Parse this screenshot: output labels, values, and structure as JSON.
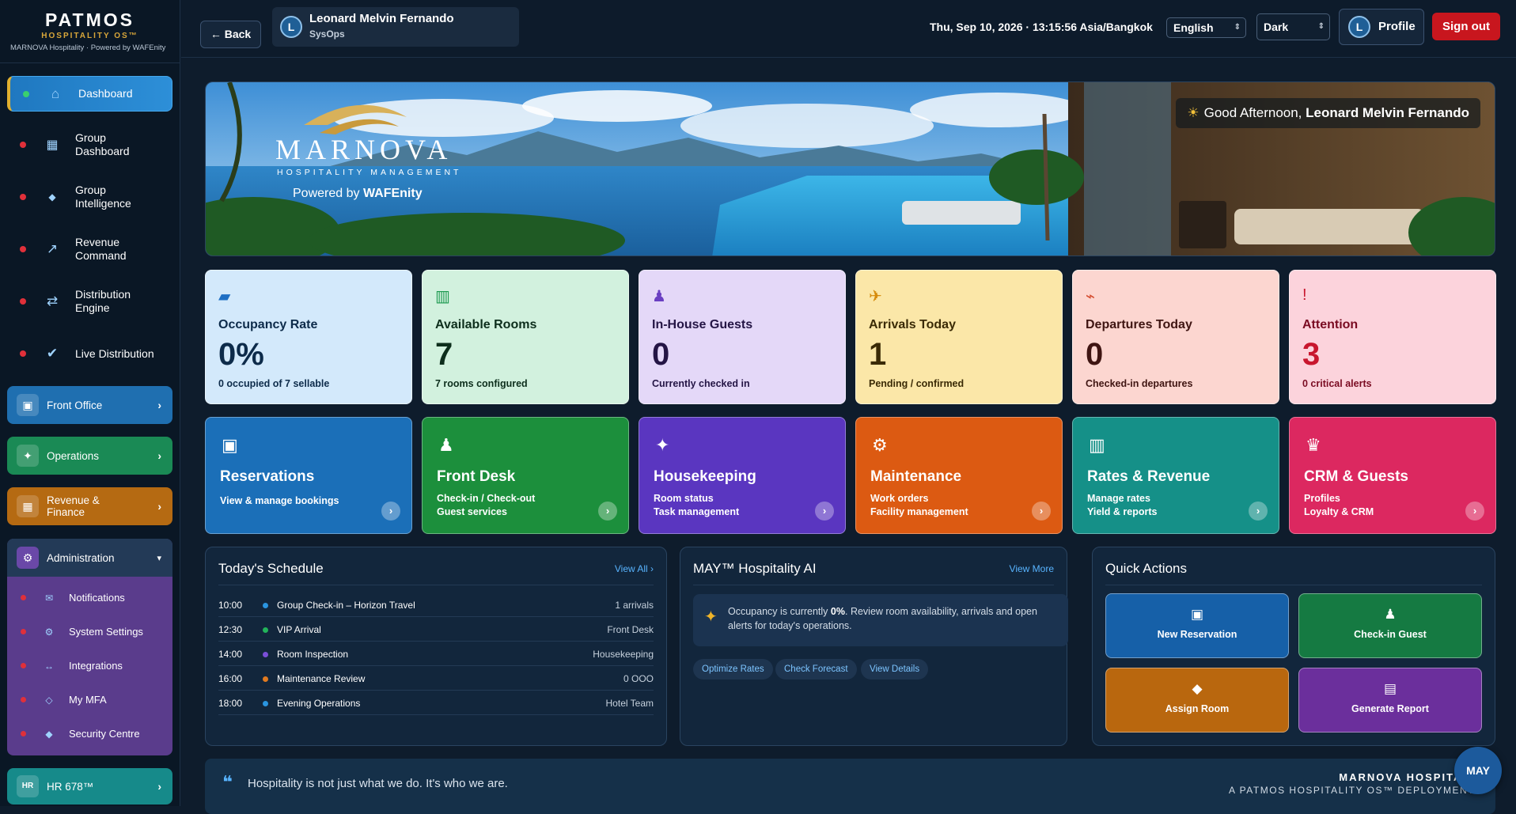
{
  "brand": {
    "name": "PATMOS",
    "os": "HOSPITALITY OS™",
    "sub": "MARNOVA Hospitality · Powered by WAFEnity"
  },
  "sidebar": {
    "items": [
      {
        "label": "Dashboard",
        "icon": "home-icon",
        "active": true
      },
      {
        "label": "Group Dashboard",
        "icon": "grid-icon"
      },
      {
        "label": "Group Intelligence",
        "icon": "diamond-icon"
      },
      {
        "label": "Revenue Command",
        "icon": "trend-arrow-icon"
      },
      {
        "label": "Distribution Engine",
        "icon": "swap-arrows-icon"
      },
      {
        "label": "Live Distribution",
        "icon": "check-icon"
      }
    ],
    "groups": [
      {
        "label": "Front Office",
        "color": "#1f6fb0"
      },
      {
        "label": "Operations",
        "color": "#1a8a55"
      },
      {
        "label": "Revenue & Finance",
        "color": "#b56a12"
      },
      {
        "label": "Administration",
        "color": "#2a3f5c"
      }
    ],
    "admin_items": [
      "Notifications",
      "System Settings",
      "Integrations",
      "My MFA",
      "Security Centre"
    ],
    "hr": {
      "badge": "HR",
      "label": "HR 678™"
    }
  },
  "topbar": {
    "back_label": "← Back",
    "user": {
      "initial": "L",
      "name": "Leonard Melvin Fernando",
      "role": "SysOps"
    },
    "clock": "Thu, Sep 10, 2026 · 13:15:56 Asia/Bangkok",
    "language": "English",
    "theme": "Dark",
    "profile_label": "Profile",
    "signout_label": "Sign out"
  },
  "hero": {
    "logo_word": "MARNOVA",
    "logo_tag": "HOSPITALITY MANAGEMENT",
    "powered_prefix": "Powered by ",
    "powered_brand": "WAFEnity",
    "greeting_prefix": "Good Afternoon, ",
    "greeting_name": "Leonard Melvin Fernando"
  },
  "stats": [
    {
      "title": "Occupancy Rate",
      "value": "0%",
      "sub": "0 occupied of 7 sellable",
      "bg": "#d3e9fb",
      "fg": "#0d2b4a",
      "accent": "#1e6fc4",
      "icon": "bed-icon"
    },
    {
      "title": "Available Rooms",
      "value": "7",
      "sub": "7 rooms configured",
      "bg": "#d2f1de",
      "fg": "#0d2e1c",
      "accent": "#1d9a50",
      "icon": "building-icon"
    },
    {
      "title": "In-House Guests",
      "value": "0",
      "sub": "Currently checked in",
      "bg": "#e4d8f8",
      "fg": "#241545",
      "accent": "#6a3fc2",
      "icon": "person-icon"
    },
    {
      "title": "Arrivals Today",
      "value": "1",
      "sub": "Pending / confirmed",
      "bg": "#fbe7a8",
      "fg": "#3a2a05",
      "accent": "#d68a0a",
      "icon": "plane-icon"
    },
    {
      "title": "Departures Today",
      "value": "0",
      "sub": "Checked-in departures",
      "bg": "#fcd6d0",
      "fg": "#3f1512",
      "accent": "#d44b2e",
      "icon": "departure-icon"
    },
    {
      "title": "Attention",
      "value": "3",
      "sub": "0 critical alerts",
      "bg": "#fcd3dc",
      "fg": "#7a0b22",
      "accent": "#c8162e",
      "icon": "alert-icon"
    }
  ],
  "modules": [
    {
      "title": "Reservations",
      "lines": [
        "View & manage bookings"
      ],
      "bg": "#1b6fb8",
      "icon": "calendar-icon"
    },
    {
      "title": "Front Desk",
      "lines": [
        "Check-in / Check-out",
        "Guest services"
      ],
      "bg": "#1c8f3c",
      "icon": "bell-icon"
    },
    {
      "title": "Housekeeping",
      "lines": [
        "Room status",
        "Task management"
      ],
      "bg": "#5a36c0",
      "icon": "sparkle-icon"
    },
    {
      "title": "Maintenance",
      "lines": [
        "Work orders",
        "Facility management"
      ],
      "bg": "#dc5a12",
      "icon": "gear-icon"
    },
    {
      "title": "Rates & Revenue",
      "lines": [
        "Manage rates",
        "Yield & reports"
      ],
      "bg": "#159088",
      "icon": "chart-icon"
    },
    {
      "title": "CRM & Guests",
      "lines": [
        "Profiles",
        "Loyalty & CRM"
      ],
      "bg": "#dc2860",
      "icon": "crown-icon"
    }
  ],
  "schedule": {
    "title": "Today's Schedule",
    "link": "View All ›",
    "rows": [
      {
        "time": "10:00",
        "event": "Group Check-in – Horizon Travel",
        "right": "1 arrivals",
        "color": "#2a95e0"
      },
      {
        "time": "12:30",
        "event": "VIP Arrival",
        "right": "Front Desk",
        "color": "#22b35a"
      },
      {
        "time": "14:00",
        "event": "Room Inspection",
        "right": "Housekeeping",
        "color": "#7a4fd8"
      },
      {
        "time": "16:00",
        "event": "Maintenance Review",
        "right": "0 OOO",
        "color": "#e07a20"
      },
      {
        "time": "18:00",
        "event": "Evening Operations",
        "right": "Hotel Team",
        "color": "#2a95e0"
      }
    ]
  },
  "ai": {
    "title": "MAY™ Hospitality AI",
    "link": "View More",
    "msg_prefix": "Occupancy is currently ",
    "msg_value": "0%",
    "msg_suffix": ". Review room availability, arrivals and open alerts for today's operations.",
    "chips": [
      "Optimize Rates",
      "Check Forecast",
      "View Details"
    ]
  },
  "quick": {
    "title": "Quick Actions",
    "actions": [
      {
        "label": "New Reservation",
        "bg": "#1660a8",
        "icon": "calendar-icon"
      },
      {
        "label": "Check-in Guest",
        "bg": "#157a42",
        "icon": "bell-icon"
      },
      {
        "label": "Assign Room",
        "bg": "#b9670e",
        "icon": "key-icon"
      },
      {
        "label": "Generate Report",
        "bg": "#6b2f9c",
        "icon": "report-icon"
      }
    ]
  },
  "quote": {
    "text": "Hospitality is not just what we do. It's who we are.",
    "brand_line1": "MARNOVA HOSPITALI",
    "brand_line2": "A PATMOS HOSPITALITY OS™ DEPLOYMENT"
  },
  "may_button": "MAY"
}
